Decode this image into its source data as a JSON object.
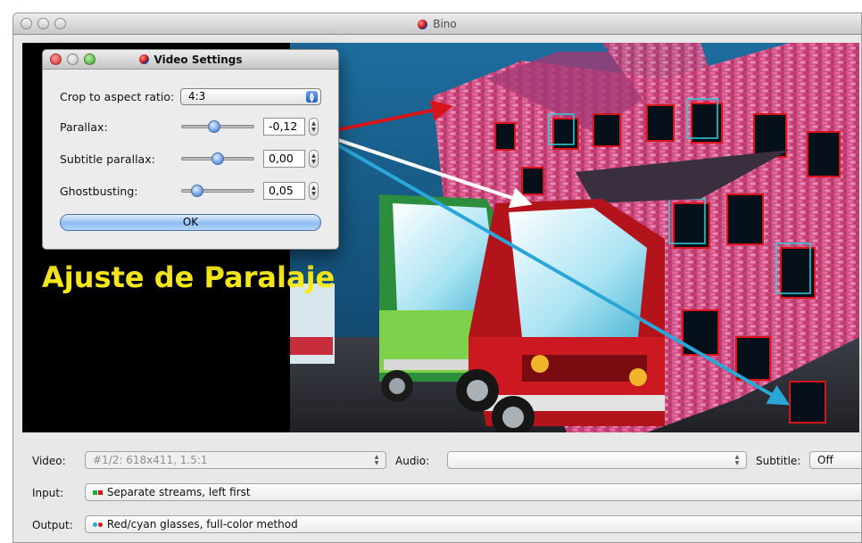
{
  "window": {
    "title": "Bino"
  },
  "overlay": {
    "text": "Ajuste de Paralaje",
    "color": "#f6e71c"
  },
  "dialog": {
    "title": "Video Settings",
    "crop": {
      "label": "Crop to aspect ratio:",
      "value": "4:3"
    },
    "parallax": {
      "label": "Parallax:",
      "value": "-0,12",
      "level": 0.44
    },
    "subtitle_parallax": {
      "label": "Subtitle parallax:",
      "value": "0,00",
      "level": 0.5
    },
    "ghostbusting": {
      "label": "Ghostbusting:",
      "value": "0,05",
      "level": 0.15
    },
    "ok_label": "OK"
  },
  "controls": {
    "video": {
      "label": "Video:",
      "value": "#1/2: 618x411, 1.5:1"
    },
    "audio": {
      "label": "Audio:",
      "value": ""
    },
    "subtitle": {
      "label": "Subtitle:",
      "value": "Off"
    },
    "input": {
      "label": "Input:",
      "value": "Separate streams, left first"
    },
    "output": {
      "label": "Output:",
      "value": "Red/cyan glasses, full-color method"
    }
  },
  "colors": {
    "arrow_red": "#d8141b",
    "arrow_white": "#ffffff",
    "arrow_cyan": "#29a7d6",
    "accent": "#3d7fd9"
  }
}
